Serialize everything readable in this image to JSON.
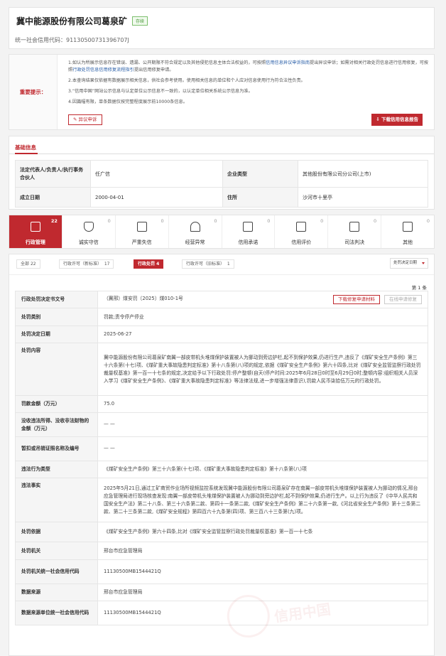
{
  "header": {
    "company_name": "冀中能源股份有限公司葛泉矿",
    "status_badge": "存续",
    "credit_code": "统一社会信用代码：91130500731396707J"
  },
  "notice": {
    "label": "重要提示：",
    "line1_a": "1.如认为所展示信息存在错误、遗漏、公开期限不符合规定以及其他侵犯信息主体合法权益的，可按照",
    "line1_link1": "信用信息异议申诉指南",
    "line1_b": "提出异议申诉；如需对相关行政处罚信息进",
    "line1_c": "行信用修复，可按照",
    "line1_link2": "行政处罚信息信用修复流程指引",
    "line1_d": "提出信用修复申请。",
    "line2": "2.本查询结果仅依据有数据展示相关信息，供社会参考使用。使用相关信息的单位和个人应对信息使用行为符合法性负责。",
    "line3": "3.“信用中国”网站公示信息与认定单位公示信息不一致的，以认定单位相关系统公示信息为准。",
    "line4": "4.因篇幅有限，单条数据仅按完整程度展示前10000条信息。",
    "objection_button": "异议申诉",
    "download_button": "下载信用信息报告"
  },
  "basic": {
    "section_title": "基础信息",
    "rows": [
      {
        "k1": "法定代表人/负责人/执行事务合伙人",
        "v1": "任广信",
        "k2": "企业类型",
        "v2": "其他股份有限公司分公司(上市)"
      },
      {
        "k1": "成立日期",
        "v1": "2000-04-01",
        "k2": "住所",
        "v2": "沙河市十里亭"
      }
    ]
  },
  "tabs": [
    {
      "name": "行政管理",
      "count": "22",
      "icon": "admin-doc-icon"
    },
    {
      "name": "诚实守信",
      "count": "0",
      "icon": "shield-check-icon"
    },
    {
      "name": "严重失信",
      "count": "0",
      "icon": "warning-book-icon"
    },
    {
      "name": "经营异常",
      "count": "0",
      "icon": "alarm-lamp-icon"
    },
    {
      "name": "信用承诺",
      "count": "0",
      "icon": "promise-doc-icon"
    },
    {
      "name": "信用评价",
      "count": "0",
      "icon": "evaluation-list-icon"
    },
    {
      "name": "司法判决",
      "count": "0",
      "icon": "judgement-doc-icon"
    },
    {
      "name": "其他",
      "count": "0",
      "icon": "other-doc-icon"
    }
  ],
  "filters": {
    "chips": [
      {
        "label": "全部",
        "count": "22"
      },
      {
        "label": "行政许可（新标准）",
        "count": "17"
      },
      {
        "label": "行政处罚",
        "count": "4"
      },
      {
        "label": "行政许可（旧标准）",
        "count": "1"
      }
    ],
    "sort_select": "处罚决定日期"
  },
  "record": {
    "page_label": "第 1 条",
    "download_repair": "下载修复申请材料",
    "online_repair": "在线申请修复",
    "rows": [
      {
        "k": "行政处罚决定书文号",
        "v": "（冀邢）煤安罚〔2025〕煤010-1号"
      },
      {
        "k": "处罚类别",
        "v": "罚款;责令停产停业"
      },
      {
        "k": "处罚决定日期",
        "v": "2025-06-27"
      },
      {
        "k": "处罚内容",
        "v": "冀中能源股份有限公司葛泉矿南翼一部皮带机头堆煤保护装置被人为挪动到旁边护栏,起不到保护效果,仍进行生产,违反了《煤矿安全生产条例》第三十六条第(十七)项、《煤矿重大事故隐患判定标准》第十八条第(八)项的规定,依据《煤矿安全生产条例》第六十四条,比对《煤矿安全监管监察行政处罚裁量权基准》第一百一十七条的规定,决定给予以下行政处罚:停产整顿(自天(停产时间:2025年6月28日0时至6月29日0时;整顿内容:组织相关人员深入学习《煤矿安全生产条例》、《煤矿重大事故隐患判定标准》等法律法规,进一步增强法律意识),罚款人民币柒拾伍万元的行政处罚。"
      },
      {
        "k": "罚款金额（万元）",
        "v": "75.0"
      },
      {
        "k": "没收违法所得、没收非法财物的金额（万元）",
        "v": "— —"
      },
      {
        "k": "暂扣或吊销证照名称及编号",
        "v": "— —"
      },
      {
        "k": "违法行为类型",
        "v": "《煤矿安全生产条例》第三十六条第(十七)项、《煤矿重大事故隐患判定标准》第十八条第(八)项"
      },
      {
        "k": "违法事实",
        "v": "2025年5月21日,通过工矿商贸作业场所视频监控系统发现冀中能源股份有限公司葛泉矿存在南翼一部皮带机头堆煤保护装置被人为挪动的情况,邢台应急管理局进行现场核查发现:南翼一部皮带机头堆煤保护装置被人为挪动到旁边护栏,起不到保护效果,仍进行生产。以上行为违反了《中华人民共和国安全生产法》第二十八条、第三十六条第二款、第四十一条第二款,《煤矿安全生产条例》第二十六条第一款,《河北省安全生产条例》第十三条第二款、第二十三条第二款,《煤矿安全规程》第四百六十九条第(四)项、第三百八十三条第(九)项。"
      },
      {
        "k": "处罚依据",
        "v": "《煤矿安全生产条例》第六十四条,比对《煤矿安全监管监察行政处罚裁量权基准》第一百一十七条"
      },
      {
        "k": "处罚机关",
        "v": "邢台市应急管理局"
      },
      {
        "k": "处罚机关统一社会信用代码",
        "v": "11130500MB1544421Q"
      },
      {
        "k": "数据来源",
        "v": "邢台市应急管理局"
      },
      {
        "k": "数据来源单位统一社会信用代码",
        "v": "11130500MB1544421Q"
      }
    ]
  },
  "watermark": "信用中国",
  "colors": {
    "accent": "#c0292f",
    "badge_green": "#4a9a3a",
    "link": "#2a5fa8"
  }
}
